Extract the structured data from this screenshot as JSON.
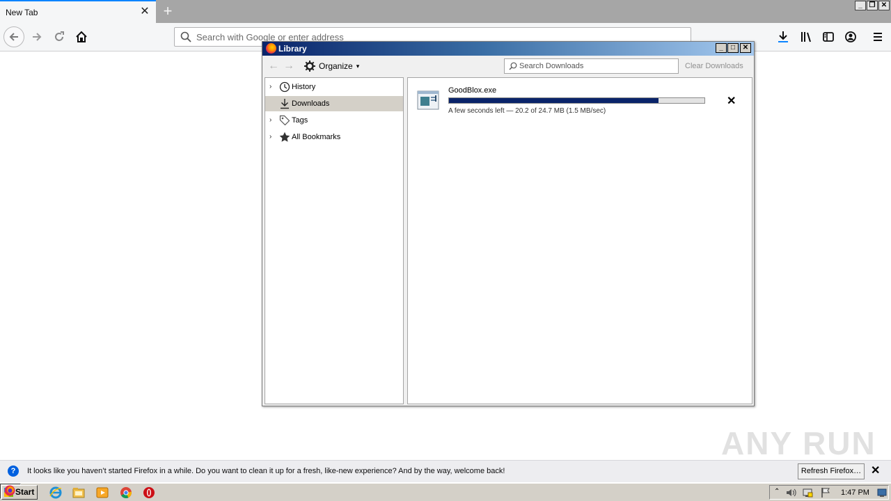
{
  "browser": {
    "tab_title": "New Tab",
    "tab_close": "✕",
    "new_tab": "+",
    "url_placeholder": "Search with Google or enter address",
    "window_controls": {
      "minimize": "_",
      "restore": "❐",
      "close": "✕"
    }
  },
  "library": {
    "title": "Library",
    "window_controls": {
      "minimize": "_",
      "maximize": "□",
      "close": "✕"
    },
    "toolbar": {
      "back": "←",
      "forward": "→",
      "organize_label": "Organize",
      "organize_caret": "▾",
      "search_placeholder": "Search Downloads",
      "clear_label": "Clear Downloads"
    },
    "sidebar": [
      {
        "label": "History",
        "twisty": "›",
        "icon": "clock-icon"
      },
      {
        "label": "Downloads",
        "twisty": "",
        "icon": "download-icon",
        "selected": true
      },
      {
        "label": "Tags",
        "twisty": "›",
        "icon": "tag-icon"
      },
      {
        "label": "All Bookmarks",
        "twisty": "›",
        "icon": "star-icon"
      }
    ],
    "download": {
      "name": "GoodBlox.exe",
      "progress": 0.82,
      "status": "A few seconds left — 20.2 of 24.7 MB (1.5 MB/sec)",
      "cancel": "✕"
    }
  },
  "notification": {
    "icon": "?",
    "text": "It looks like you haven’t started Firefox in a while. Do you want to clean it up for a fresh, like-new experience? And by the way, welcome back!",
    "refresh_label": "Refresh Firefox…",
    "close": "✕"
  },
  "watermark": "ANY RUN",
  "taskbar": {
    "start_label": "Start",
    "clock": "1:47 PM"
  },
  "colors": {
    "accent": "#0a84ff",
    "progress": "#0a246a",
    "title_gradient_start": "#0a246a",
    "title_gradient_end": "#a6caf0"
  }
}
